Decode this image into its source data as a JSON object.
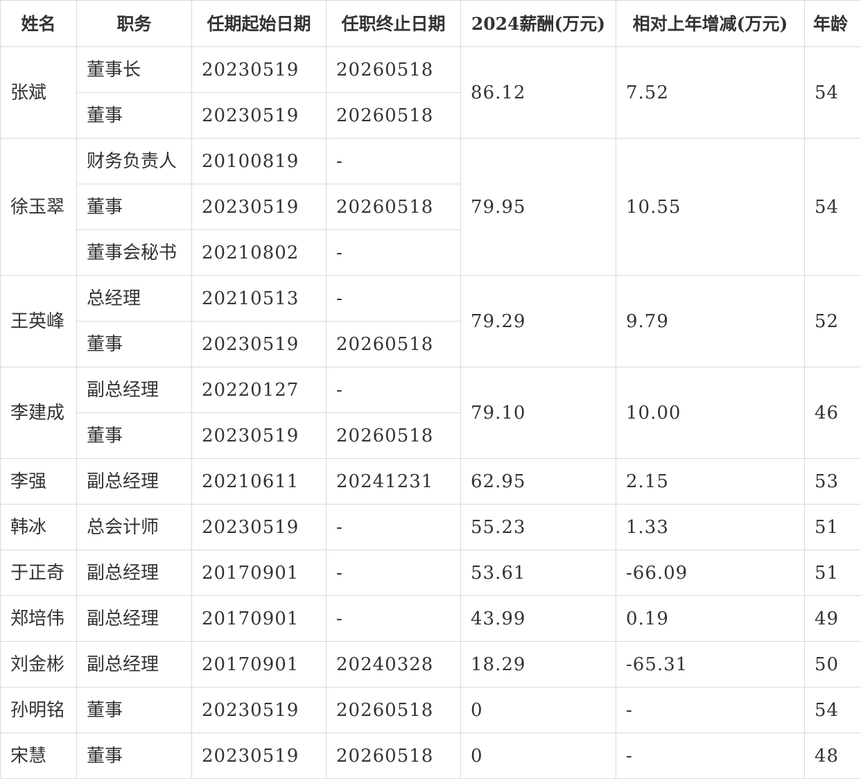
{
  "headers": [
    "姓名",
    "职务",
    "任期起始日期",
    "任职终止日期",
    "2024薪酬(万元)",
    "相对上年增减(万元)",
    "年龄"
  ],
  "people": [
    {
      "name": "张斌",
      "roles": [
        {
          "title": "董事长",
          "start": "20230519",
          "end": "20260518"
        },
        {
          "title": "董事",
          "start": "20230519",
          "end": "20260518"
        }
      ],
      "salary": "86.12",
      "change": "7.52",
      "age": "54"
    },
    {
      "name": "徐玉翠",
      "roles": [
        {
          "title": "财务负责人",
          "start": "20100819",
          "end": "-"
        },
        {
          "title": "董事",
          "start": "20230519",
          "end": "20260518"
        },
        {
          "title": "董事会秘书",
          "start": "20210802",
          "end": "-"
        }
      ],
      "salary": "79.95",
      "change": "10.55",
      "age": "54"
    },
    {
      "name": "王英峰",
      "roles": [
        {
          "title": "总经理",
          "start": "20210513",
          "end": "-"
        },
        {
          "title": "董事",
          "start": "20230519",
          "end": "20260518"
        }
      ],
      "salary": "79.29",
      "change": "9.79",
      "age": "52"
    },
    {
      "name": "李建成",
      "roles": [
        {
          "title": "副总经理",
          "start": "20220127",
          "end": "-"
        },
        {
          "title": "董事",
          "start": "20230519",
          "end": "20260518"
        }
      ],
      "salary": "79.10",
      "change": "10.00",
      "age": "46"
    },
    {
      "name": "李强",
      "roles": [
        {
          "title": "副总经理",
          "start": "20210611",
          "end": "20241231"
        }
      ],
      "salary": "62.95",
      "change": "2.15",
      "age": "53"
    },
    {
      "name": "韩冰",
      "roles": [
        {
          "title": "总会计师",
          "start": "20230519",
          "end": "-"
        }
      ],
      "salary": "55.23",
      "change": "1.33",
      "age": "51"
    },
    {
      "name": "于正奇",
      "roles": [
        {
          "title": "副总经理",
          "start": "20170901",
          "end": "-"
        }
      ],
      "salary": "53.61",
      "change": "-66.09",
      "age": "51"
    },
    {
      "name": "郑培伟",
      "roles": [
        {
          "title": "副总经理",
          "start": "20170901",
          "end": "-"
        }
      ],
      "salary": "43.99",
      "change": "0.19",
      "age": "49"
    },
    {
      "name": "刘金彬",
      "roles": [
        {
          "title": "副总经理",
          "start": "20170901",
          "end": "20240328"
        }
      ],
      "salary": "18.29",
      "change": "-65.31",
      "age": "50"
    },
    {
      "name": "孙明铭",
      "roles": [
        {
          "title": "董事",
          "start": "20230519",
          "end": "20260518"
        }
      ],
      "salary": "0",
      "change": "-",
      "age": "54"
    },
    {
      "name": "宋慧",
      "roles": [
        {
          "title": "董事",
          "start": "20230519",
          "end": "20260518"
        }
      ],
      "salary": "0",
      "change": "-",
      "age": "48"
    }
  ]
}
